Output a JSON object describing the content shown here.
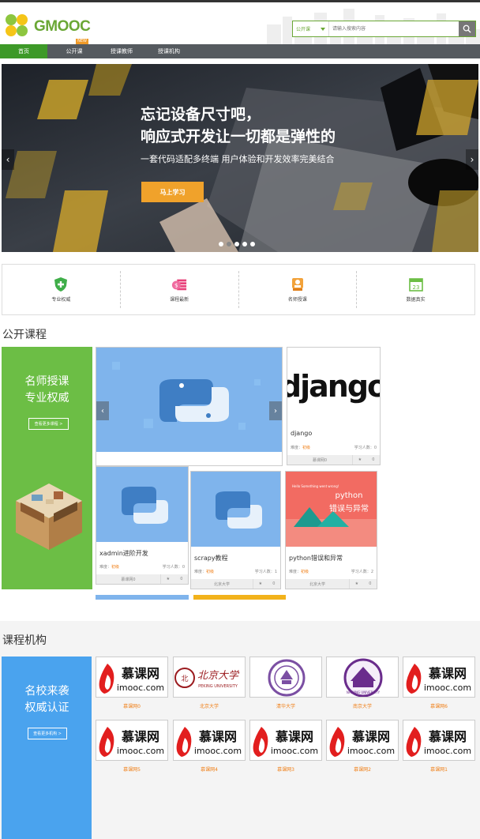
{
  "header": {
    "logo_text": "GMOOC",
    "search": {
      "type": "公开课",
      "placeholder": "请输入搜索内容"
    }
  },
  "nav": {
    "items": [
      "首页",
      "公开课",
      "授课教师",
      "授课机构"
    ],
    "badge": "NEW",
    "active_index": 0
  },
  "banner": {
    "title_line1": "忘记设备尺寸吧，",
    "title_line2": "响应式开发让一切都是弹性的",
    "subtitle": "一套代码适配多终端 用户体验和开发效率完美结合",
    "button": "马上学习",
    "slide_count": 5,
    "active_slide": 1
  },
  "features": [
    {
      "label": "专业权威",
      "icon": "shield-icon"
    },
    {
      "label": "课程最新",
      "icon": "money-icon"
    },
    {
      "label": "名师授课",
      "icon": "teacher-icon"
    },
    {
      "label": "数据真实",
      "icon": "calendar-icon"
    }
  ],
  "courses": {
    "title": "公开课程",
    "promo_line1": "名师授课",
    "promo_line2": "专业权威",
    "promo_button": "查看更多课程 >",
    "items": [
      {
        "title": "django",
        "level_label": "难度：",
        "level": "初级",
        "students_label": "学习人数：",
        "students": "0",
        "org": "慕课网0",
        "favs": "0"
      },
      {
        "title": "xadmin进阶开发",
        "level_label": "难度：",
        "level": "初级",
        "students_label": "学习人数：",
        "students": "0",
        "org": "慕课网0",
        "favs": "0"
      },
      {
        "title": "scrapy教程",
        "level_label": "难度：",
        "level": "初级",
        "students_label": "学习人数：",
        "students": "1",
        "org": "北京大学",
        "favs": "0"
      },
      {
        "title": "python错误和异常",
        "level_label": "难度：",
        "level": "初级",
        "students_label": "学习人数：",
        "students": "2",
        "org": "北京大学",
        "favs": "0"
      }
    ],
    "python_thumb_text1": "python",
    "python_thumb_text2": "错误与异常",
    "python_thumb_text3": "Hello Something went wrong!"
  },
  "orgs": {
    "title": "课程机构",
    "promo_line1": "名校来袭",
    "promo_line2": "权威认证",
    "promo_button": "查看更多机构 >",
    "row1": [
      "慕课网0",
      "北京大学",
      "清华大学",
      "南京大学",
      "慕课网6"
    ],
    "row2": [
      "慕课网5",
      "慕课网4",
      "慕课网3",
      "慕课网2",
      "慕课网1"
    ],
    "mooc_cn": "慕课网",
    "mooc_en": "imooc.com",
    "pku_cn": "北京大学",
    "pku_en": "PEKING UNIVERSITY",
    "nju_en": "NANJING UNIVERSITY"
  },
  "colors": {
    "brand_green": "#6aa735",
    "nav_active": "#3d9928",
    "accent_orange": "#f0a22b",
    "org_blue": "#4aa3ee",
    "promo_green": "#6cbe45"
  }
}
